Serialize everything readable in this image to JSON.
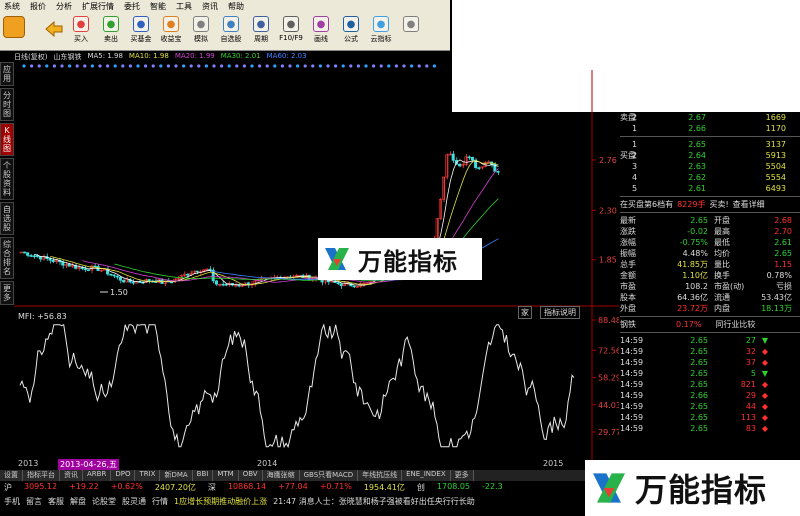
{
  "menu": {
    "items": [
      "系统",
      "报价",
      "分析",
      "扩展行情",
      "委托",
      "智能",
      "工具",
      "资讯",
      "帮助"
    ]
  },
  "toolbar": {
    "buttons": [
      {
        "label": "买入",
        "icon": "buy-icon",
        "color": "#e04040"
      },
      {
        "label": "卖出",
        "icon": "sell-icon",
        "color": "#30a030"
      },
      {
        "label": "买基金",
        "icon": "fund-icon",
        "color": "#3060c0"
      },
      {
        "label": "收益宝",
        "icon": "treasure-icon",
        "color": "#e08020"
      },
      {
        "label": "模拟",
        "icon": "simulate-icon",
        "color": "#808080"
      },
      {
        "label": "自选股",
        "icon": "favorites-icon",
        "color": "#4080c0"
      },
      {
        "label": "周期",
        "icon": "clock-icon",
        "color": "#4060a0"
      },
      {
        "label": "F10/F9",
        "icon": "f10-icon",
        "color": "#606060"
      },
      {
        "label": "画线",
        "icon": "draw-icon",
        "color": "#a040a0"
      },
      {
        "label": "公式",
        "icon": "formula-icon",
        "color": "#2060a0"
      },
      {
        "label": "云指标",
        "icon": "cloud-icon",
        "color": "#40a0e0"
      },
      {
        "label": "",
        "icon": "more-icon",
        "color": "#808080"
      }
    ]
  },
  "statusline": {
    "title": "日线(复权)",
    "stock": "山东钢铁",
    "ma5": "MA5: 1.98",
    "ma10": "MA10: 1.98",
    "ma20": "MA20: 1.99",
    "ma30": "MA30: 2.01",
    "ma60": "MA60: 2.03"
  },
  "vtabs": [
    {
      "label": "应用",
      "active": false
    },
    {
      "label": "分时图",
      "active": false
    },
    {
      "label": "K线图",
      "active": true
    },
    {
      "label": "个股资料",
      "active": false
    },
    {
      "label": "自选股",
      "active": false
    },
    {
      "label": "综合排名",
      "active": false
    },
    {
      "label": "更多",
      "active": false
    }
  ],
  "price_axis": [
    "2.76",
    "2.30",
    "1.85"
  ],
  "low_marker": "1.50",
  "mfi": {
    "title": "MFI: +56.83",
    "help": "指标说明",
    "close": "家",
    "axis": [
      "88.48",
      "72.56",
      "58.29",
      "44.03",
      "29.77"
    ]
  },
  "timeline": {
    "y2013": "2013",
    "date": "2013-04-26,五",
    "y2014": "2014",
    "y2015": "2015"
  },
  "bottom_tabs": [
    "设置",
    "指标平台",
    "资讯",
    "ARBR",
    "DPO",
    "TRIX",
    "新DMA",
    "BBI",
    "MTM",
    "OBV",
    "海鹰张缩",
    "GBS只看MACD",
    "年线抗压线",
    "ENE_INDEX",
    "更多"
  ],
  "indexbar": {
    "sh_name": "沪",
    "sh_val": "3095.12",
    "sh_chg": "+19.22",
    "sh_pct": "+0.62%",
    "sh_amt": "2407.20亿",
    "sz_name": "深",
    "sz_val": "10868.14",
    "sz_chg": "+77.04",
    "sz_pct": "+0.71%",
    "sz_amt": "1954.41亿",
    "cy_name": "创",
    "cy_val": "1708.05",
    "cy_chg": "-22.3"
  },
  "newsbar": {
    "items": [
      "手机",
      "留言",
      "客服",
      "解盘",
      "论股堂",
      "股灵通",
      "行情"
    ],
    "news": "1应增长预期推动融价上涨",
    "time": "21:47 消息人士：张晓慧和杨子强被看好出任央行行长助"
  },
  "quote": {
    "ask_label": "卖盘",
    "bid_label": "买盘",
    "asks": [
      {
        "lvl": "2",
        "price": "2.67",
        "vol": "1669"
      },
      {
        "lvl": "1",
        "price": "2.66",
        "vol": "1170"
      }
    ],
    "bids": [
      {
        "lvl": "1",
        "price": "2.65",
        "vol": "3137"
      },
      {
        "lvl": "2",
        "price": "2.64",
        "vol": "5913"
      },
      {
        "lvl": "3",
        "price": "2.63",
        "vol": "5504"
      },
      {
        "lvl": "4",
        "price": "2.62",
        "vol": "5554"
      },
      {
        "lvl": "5",
        "price": "2.61",
        "vol": "6493"
      }
    ],
    "order_note": "在买盘第6档有",
    "order_qty": "8229手",
    "order_dir": "买卖!",
    "order_detail": "查看详细",
    "stats": [
      {
        "l": "最新",
        "v": "2.65",
        "vc": "#30d030",
        "l2": "开盘",
        "v2": "2.68",
        "v2c": "#ff3030"
      },
      {
        "l": "涨跌",
        "v": "-0.02",
        "vc": "#30d030",
        "l2": "最高",
        "v2": "2.70",
        "v2c": "#ff3030"
      },
      {
        "l": "涨幅",
        "v": "-0.75%",
        "vc": "#30d030",
        "l2": "最低",
        "v2": "2.61",
        "v2c": "#30d030"
      },
      {
        "l": "振幅",
        "v": "4.48%",
        "vc": "#ddd",
        "l2": "均价",
        "v2": "2.65",
        "v2c": "#30d030"
      },
      {
        "l": "总手",
        "v": "41.85万",
        "vc": "#e0e040",
        "l2": "量比",
        "v2": "1.15",
        "v2c": "#ff3030"
      },
      {
        "l": "金额",
        "v": "1.10亿",
        "vc": "#e0e040",
        "l2": "换手",
        "v2": "0.78%",
        "v2c": "#ddd"
      },
      {
        "l": "市盈",
        "v": "108.2",
        "vc": "#ddd",
        "l2": "市盈(动)",
        "v2": "亏损",
        "v2c": "#ddd"
      },
      {
        "l": "股本",
        "v": "64.36亿",
        "vc": "#ddd",
        "l2": "流通",
        "v2": "53.43亿",
        "v2c": "#ddd"
      },
      {
        "l": "外盘",
        "v": "23.72万",
        "vc": "#ff3030",
        "l2": "内盘",
        "v2": "18.13万",
        "v2c": "#30d030"
      }
    ],
    "sector": "钢铁",
    "sector_pct": "0.17%",
    "sector_cmp": "同行业比较",
    "ticks": [
      {
        "t": "14:59",
        "p": "2.65",
        "v": "27",
        "c": "#30d030"
      },
      {
        "t": "14:59",
        "p": "2.65",
        "v": "32",
        "c": "#ff3030"
      },
      {
        "t": "14:59",
        "p": "2.65",
        "v": "37",
        "c": "#ff3030"
      },
      {
        "t": "14:59",
        "p": "2.65",
        "v": "5",
        "c": "#30d030"
      },
      {
        "t": "14:59",
        "p": "2.65",
        "v": "821",
        "c": "#ff3030"
      },
      {
        "t": "14:59",
        "p": "2.66",
        "v": "29",
        "c": "#ff3030"
      },
      {
        "t": "14:59",
        "p": "2.65",
        "v": "44",
        "c": "#ff3030"
      },
      {
        "t": "14:59",
        "p": "2.65",
        "v": "113",
        "c": "#ff3030"
      },
      {
        "t": "14:59",
        "p": "2.65",
        "v": "83",
        "c": "#ff3030"
      }
    ]
  },
  "logo": {
    "text": "万能指标"
  }
}
